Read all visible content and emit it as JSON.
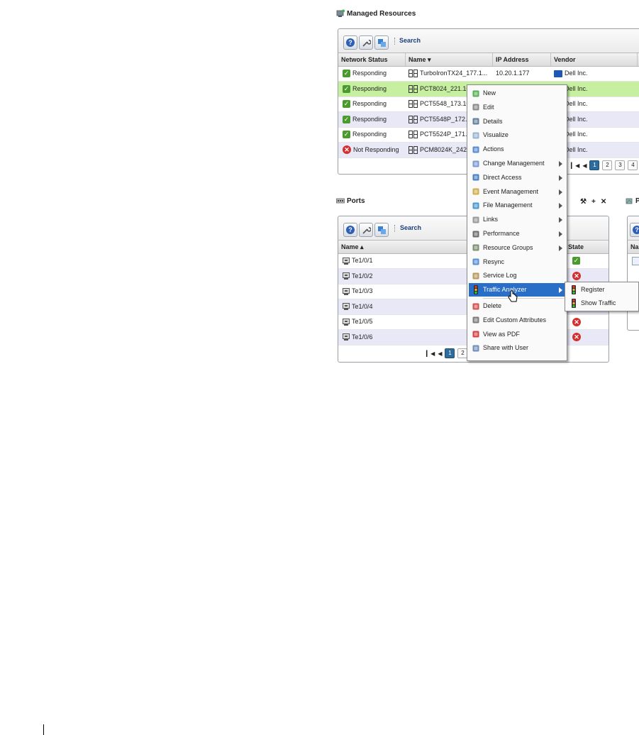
{
  "managed": {
    "title": "Managed Resources",
    "search": "Search",
    "columns": [
      "Network Status",
      "Name ▾",
      "IP Address",
      "Vendor"
    ],
    "rows": [
      {
        "status": "Responding",
        "ok": true,
        "name": "TurboIronTX24_177.1...",
        "ip": "10.20.1.177",
        "vendor": "Dell Inc."
      },
      {
        "status": "Responding",
        "ok": true,
        "name": "PCT8024_221.10",
        "ip": "",
        "vendor": "Dell Inc."
      },
      {
        "status": "Responding",
        "ok": true,
        "name": "PCT5548_173.10",
        "ip": "",
        "vendor": "Dell Inc."
      },
      {
        "status": "Responding",
        "ok": true,
        "name": "PCT5548P_172.1",
        "ip": "",
        "vendor": "Dell Inc."
      },
      {
        "status": "Responding",
        "ok": true,
        "name": "PCT5524P_171.1",
        "ip": "",
        "vendor": "Dell Inc."
      },
      {
        "status": "Not Responding",
        "ok": false,
        "name": "PCM8024K_242.",
        "ip": "",
        "vendor": "Dell Inc."
      }
    ],
    "pages": [
      "1",
      "2",
      "3",
      "4"
    ]
  },
  "ports": {
    "title": "Ports",
    "search": "Search",
    "columns": [
      "Name ▴",
      "State"
    ],
    "rows": [
      {
        "name": "Te1/0/1",
        "ok": true
      },
      {
        "name": "Te1/0/2",
        "ok": false
      },
      {
        "name": "Te1/0/3",
        "ok": null
      },
      {
        "name": "Te1/0/4",
        "ok": null
      },
      {
        "name": "Te1/0/5",
        "ok": false
      },
      {
        "name": "Te1/0/6",
        "ok": false
      }
    ],
    "pages": [
      "1",
      "2"
    ],
    "toolbar_actions": [
      "⚒",
      "+",
      "✕"
    ]
  },
  "right_panel": {
    "title_fragment": "P",
    "header_fragment": "Na"
  },
  "context_menu": {
    "items": [
      {
        "label": "New",
        "icon": "new-icon",
        "submenu": false
      },
      {
        "label": "Edit",
        "icon": "edit-icon",
        "submenu": false
      },
      {
        "label": "Details",
        "icon": "details-icon",
        "submenu": false
      },
      {
        "label": "Visualize",
        "icon": "visualize-icon",
        "submenu": false
      },
      {
        "label": "Actions",
        "icon": "actions-icon",
        "submenu": false
      },
      {
        "label": "Change Management",
        "icon": "change-management-icon",
        "submenu": true
      },
      {
        "label": "Direct Access",
        "icon": "direct-access-icon",
        "submenu": true
      },
      {
        "label": "Event Management",
        "icon": "event-management-icon",
        "submenu": true
      },
      {
        "label": "File Management",
        "icon": "file-management-icon",
        "submenu": true
      },
      {
        "label": "Links",
        "icon": "links-icon",
        "submenu": true
      },
      {
        "label": "Performance",
        "icon": "performance-icon",
        "submenu": true
      },
      {
        "label": "Resource Groups",
        "icon": "resource-groups-icon",
        "submenu": true
      },
      {
        "label": "Resync",
        "icon": "resync-icon",
        "submenu": false
      },
      {
        "label": "Service Log",
        "icon": "service-log-icon",
        "submenu": false
      },
      {
        "label": "Traffic Analyzer",
        "icon": "traffic-analyzer-icon",
        "submenu": true,
        "highlighted": true
      },
      {
        "label": "Delete",
        "icon": "delete-icon",
        "submenu": false
      },
      {
        "label": "Edit Custom Attributes",
        "icon": "custom-attributes-icon",
        "submenu": false
      },
      {
        "label": "View as PDF",
        "icon": "pdf-icon",
        "submenu": false
      },
      {
        "label": "Share with User",
        "icon": "share-icon",
        "submenu": false
      }
    ],
    "submenu": [
      "Register",
      "Show Traffic"
    ]
  }
}
